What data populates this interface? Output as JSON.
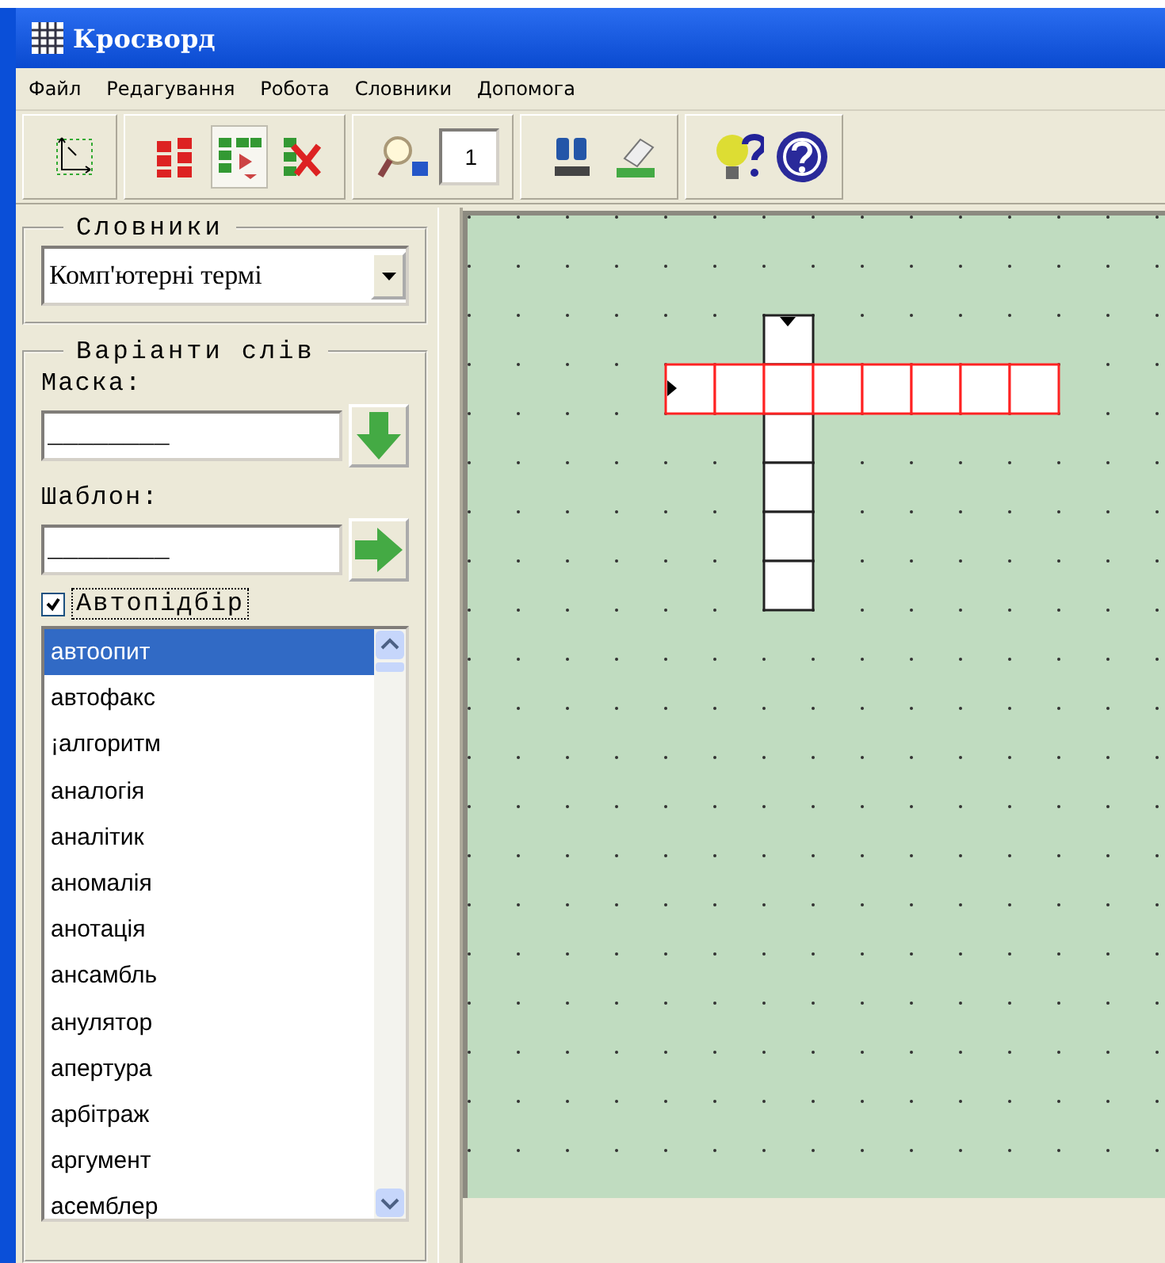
{
  "window": {
    "title": "Кросворд"
  },
  "menu": [
    {
      "label": "Файл"
    },
    {
      "label": "Редагування"
    },
    {
      "label": "Робота"
    },
    {
      "label": "Словники"
    },
    {
      "label": "Допомога"
    }
  ],
  "toolbar": [
    {
      "kind": "axes",
      "pressed": false
    },
    {
      "kind": "separator"
    },
    {
      "kind": "blocks",
      "pressed": false
    },
    {
      "kind": "blocks-down",
      "pressed": true
    },
    {
      "kind": "blocks-delete",
      "pressed": false
    },
    {
      "kind": "separator"
    },
    {
      "kind": "magnifier",
      "pressed": false
    },
    {
      "kind": "number",
      "value": "1"
    },
    {
      "kind": "separator"
    },
    {
      "kind": "binoculars",
      "pressed": false
    },
    {
      "kind": "eraser",
      "pressed": false
    },
    {
      "kind": "separator"
    },
    {
      "kind": "hint",
      "pressed": false
    },
    {
      "kind": "help",
      "pressed": false
    }
  ],
  "dictionaries": {
    "title": "Словники",
    "value": "Комп'ютерні термі"
  },
  "variants": {
    "title": "Варіанти слів",
    "mask_label": "Маска:",
    "mask_value": "________",
    "template_label": "Шаблон:",
    "template_value": "________",
    "auto_label": "Автопідбір",
    "auto_checked": true
  },
  "words": [
    {
      "label": "автоопит",
      "selected": true
    },
    {
      "label": "автофакс",
      "selected": false
    },
    {
      "label": "¡алгоритм",
      "selected": false
    },
    {
      "label": "аналогія",
      "selected": false
    },
    {
      "label": "аналітик",
      "selected": false
    },
    {
      "label": "аномалія",
      "selected": false
    },
    {
      "label": "анотація",
      "selected": false
    },
    {
      "label": "ансамбль",
      "selected": false
    },
    {
      "label": "анулятор",
      "selected": false
    },
    {
      "label": "апертура",
      "selected": false
    },
    {
      "label": "арбітраж",
      "selected": false
    },
    {
      "label": "аргумент",
      "selected": false
    },
    {
      "label": "асемблер",
      "selected": false
    }
  ],
  "crossword": {
    "entries": [
      {
        "selected": true
      },
      {
        "selected": false
      }
    ]
  }
}
